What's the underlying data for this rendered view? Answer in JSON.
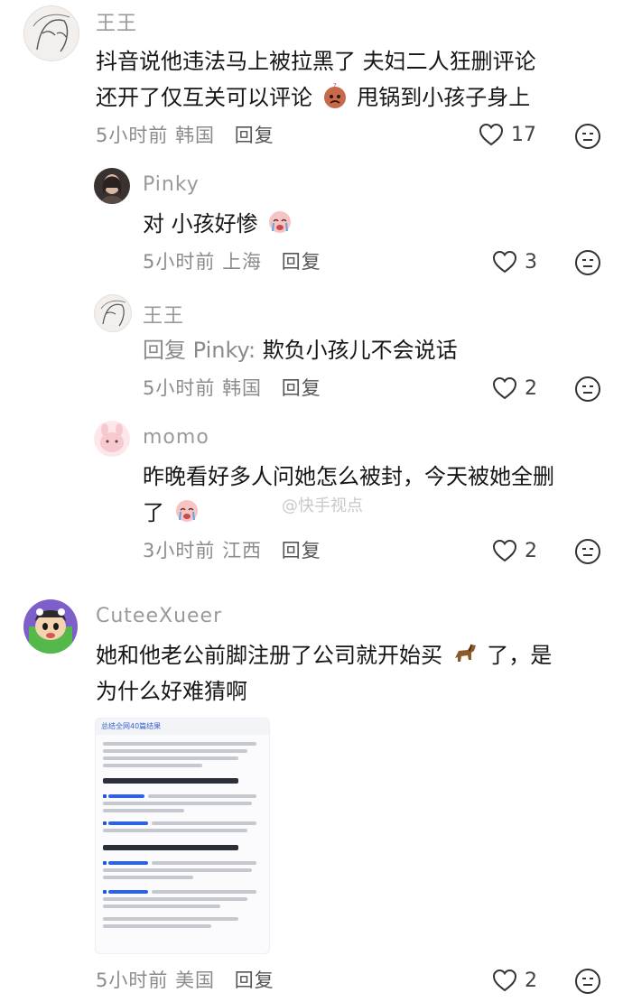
{
  "colors": {
    "accent": "#3a64c7",
    "meta": "#8c8c8c",
    "text": "#161616"
  },
  "comments": [
    {
      "user": "王王",
      "text_line1": "抖音说他违法马上被拉黑了 夫妇二人狂删评论",
      "text_line2_a": "还开了仅互关可以评论",
      "text_line2_b": "甩锅到小孩子身上",
      "time": "5小时前",
      "location": "韩国",
      "reply_label": "回复",
      "likes": "17",
      "replies": [
        {
          "user": "Pinky",
          "text": "对 小孩好惨",
          "time": "5小时前",
          "location": "上海",
          "reply_label": "回复",
          "likes": "3"
        },
        {
          "user": "王王",
          "reply_prefix": "回复 Pinky:",
          "text": "欺负小孩儿不会说话",
          "time": "5小时前",
          "location": "韩国",
          "reply_label": "回复",
          "likes": "2"
        },
        {
          "user": "momo",
          "text_line1": "昨晚看好多人问她怎么被封，今天被她全删",
          "text_line2": "了",
          "time": "3小时前",
          "location": "江西",
          "reply_label": "回复",
          "likes": "2"
        }
      ]
    },
    {
      "user": "CuteeXueer",
      "text_line1_a": "她和他老公前脚注册了公司就开始买",
      "text_line1_b": "了，是",
      "text_line2": "为什么好难猜啊",
      "time": "5小时前",
      "location": "美国",
      "reply_label": "回复",
      "likes": "2",
      "image_title": "总结全网40篇结果"
    }
  ],
  "watermark": "@快手视点",
  "icons": [
    "heart-icon",
    "dislike-face-icon",
    "emoji-icon",
    "horse-icon"
  ]
}
